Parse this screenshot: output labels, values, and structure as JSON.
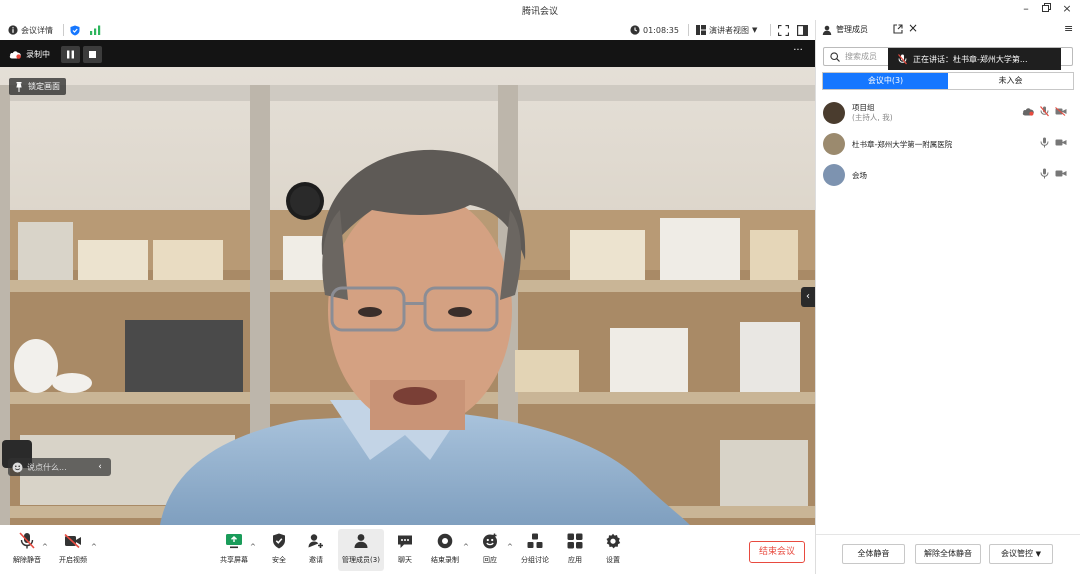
{
  "window": {
    "title": "腾讯会议"
  },
  "toolbar": {
    "meeting_info": "会议详情",
    "timer": "01:08:35",
    "view_mode": "演讲者视图"
  },
  "video": {
    "recording_label": "录制中",
    "lock_label": "锁定画面",
    "chat_placeholder": "说点什么..."
  },
  "bottombar": {
    "items": [
      {
        "label": "解除静音"
      },
      {
        "label": "开启视频"
      },
      {
        "label": "共享屏幕"
      },
      {
        "label": "安全"
      },
      {
        "label": "邀请"
      },
      {
        "label": "管理成员(3)"
      },
      {
        "label": "聊天"
      },
      {
        "label": "结束录制"
      },
      {
        "label": "回应"
      },
      {
        "label": "分组讨论"
      },
      {
        "label": "应用"
      },
      {
        "label": "设置"
      }
    ],
    "end_meeting": "结束会议"
  },
  "panel": {
    "title": "管理成员",
    "search_placeholder": "搜索成员",
    "speaking": "正在讲话：杜书章-郑州大学第...",
    "tabs": [
      {
        "label": "会议中(3)",
        "active": true
      },
      {
        "label": "未入会",
        "active": false
      }
    ],
    "members": [
      {
        "name": "项目组",
        "sub": "(主持人, 我)"
      },
      {
        "name": "杜书章-郑州大学第一附属医院",
        "sub": ""
      },
      {
        "name": "会场",
        "sub": ""
      }
    ],
    "footer": {
      "mute_all": "全体静音",
      "unmute_all": "解除全体静音",
      "meeting_control": "会议管控"
    }
  },
  "colors": {
    "accent": "#1677ff",
    "danger": "#e84a3f",
    "signal": "#2db55d"
  }
}
